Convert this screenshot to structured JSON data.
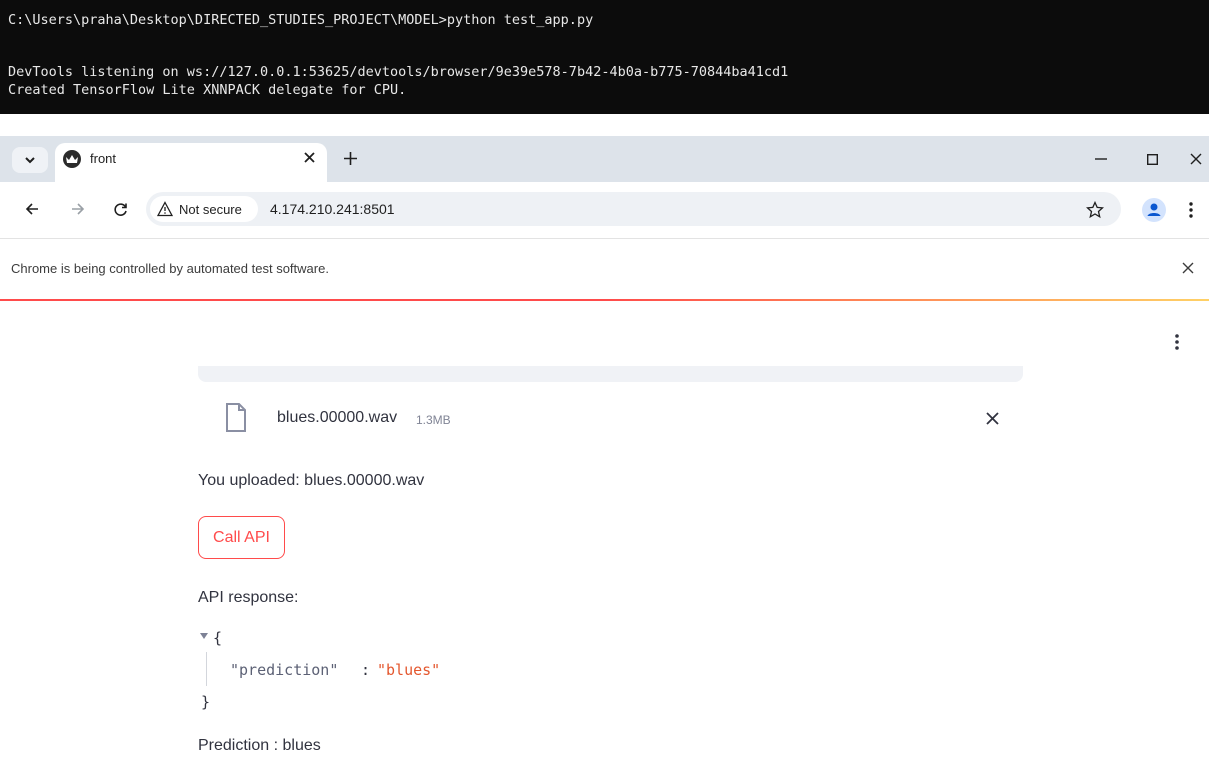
{
  "terminal": {
    "lines": [
      "C:\\Users\\praha\\Desktop\\DIRECTED_STUDIES_PROJECT\\MODEL>python test_app.py",
      "DevTools listening on ws://127.0.0.1:53625/devtools/browser/9e39e578-7b42-4b0a-b775-70844ba41cd1",
      "Created TensorFlow Lite XNNPACK delegate for CPU."
    ]
  },
  "browser": {
    "tab_title": "front",
    "security_label": "Not secure",
    "url": "4.174.210.241:8501",
    "infobar_text": "Chrome is being controlled by automated test software."
  },
  "app": {
    "file": {
      "name": "blues.00000.wav",
      "size": "1.3MB"
    },
    "uploaded_text": "You uploaded: blues.00000.wav",
    "call_button_label": "Call API",
    "response_label": "API response:",
    "json": {
      "open": "{",
      "key": "\"prediction\"",
      "colon": ":",
      "value": "\"blues\"",
      "close": "}"
    },
    "prediction_text": "Prediction : blues"
  },
  "colors": {
    "accent": "#ff4b4b",
    "terminal_bg": "#0c0c0c",
    "json_string": "#e4572e"
  }
}
